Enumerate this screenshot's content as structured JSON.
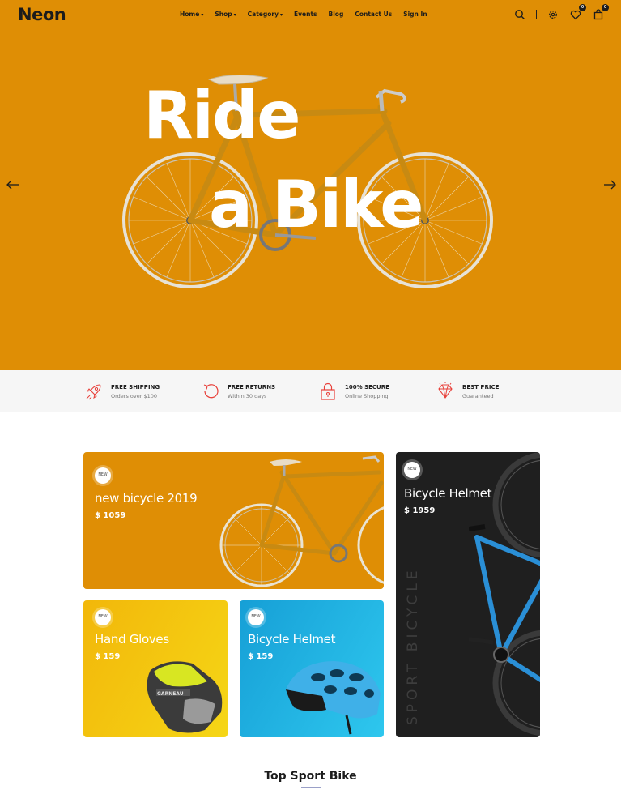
{
  "brand": {
    "logo": "Neon"
  },
  "nav": {
    "items": [
      {
        "label": "Home",
        "has_dropdown": true
      },
      {
        "label": "Shop",
        "has_dropdown": true
      },
      {
        "label": "Category",
        "has_dropdown": true
      },
      {
        "label": "Events",
        "has_dropdown": false
      },
      {
        "label": "Blog",
        "has_dropdown": false
      },
      {
        "label": "Contact Us",
        "has_dropdown": false
      },
      {
        "label": "Sign In",
        "has_dropdown": false
      }
    ],
    "icons": [
      "search-icon",
      "settings-icon",
      "wishlist-icon",
      "cart-icon"
    ],
    "wishlist_count": "0",
    "cart_count": "0"
  },
  "hero": {
    "title_line1": "Ride",
    "title_line2": "a Bike",
    "background": "#df8e05",
    "prev_icon": "arrow-left-icon",
    "next_icon": "arrow-right-icon"
  },
  "features": [
    {
      "icon": "rocket-icon",
      "title": "FREE SHIPPING",
      "subtitle": "Orders over $100"
    },
    {
      "icon": "return-icon",
      "title": "FREE RETURNS",
      "subtitle": "Within 30 days"
    },
    {
      "icon": "lock-icon",
      "title": "100% SECURE",
      "subtitle": "Online Shopping"
    },
    {
      "icon": "diamond-icon",
      "title": "BEST PRICE",
      "subtitle": "Guaranteed"
    }
  ],
  "banners": [
    {
      "badge": "NEW",
      "title": "new bicycle 2019",
      "price": "$ 1059"
    },
    {
      "badge": "NEW",
      "title": "Hand Gloves",
      "price": "$ 159"
    },
    {
      "badge": "NEW",
      "title": "Bicycle Helmet",
      "price": "$ 159"
    },
    {
      "badge": "NEW",
      "title": "Bicycle Helmet",
      "price": "$ 1959",
      "vertical_text": "SPORT BICYCLE"
    }
  ],
  "section": {
    "title": "Top Sport Bike"
  },
  "colors": {
    "accent": "#df8e05",
    "feature_icon": "#e8403a",
    "dark_card": "#1f1f1f"
  }
}
